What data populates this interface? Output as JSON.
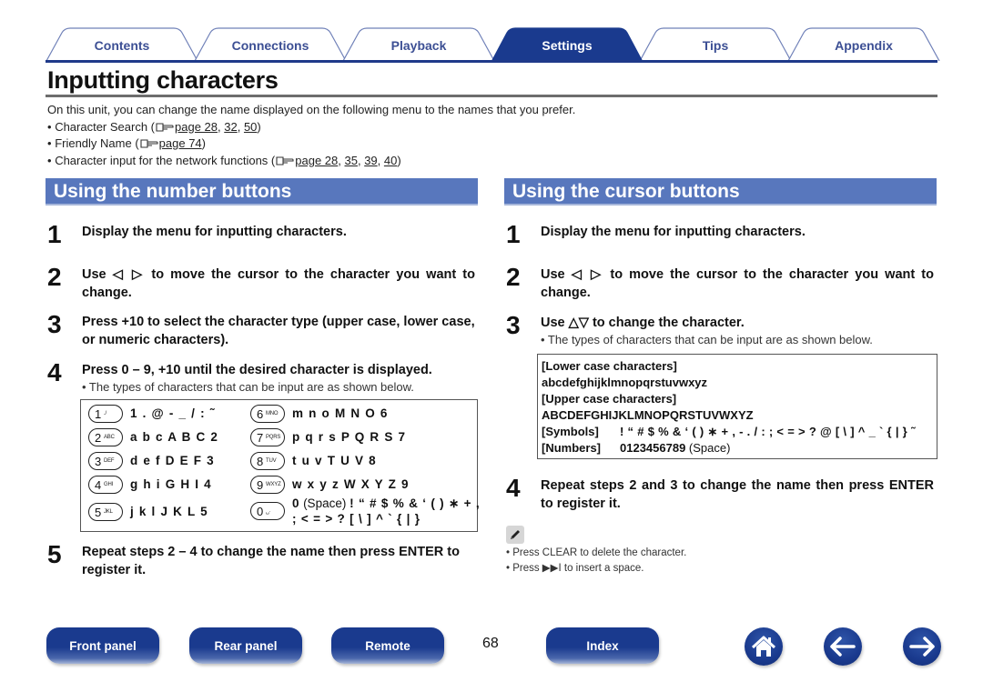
{
  "tabs": [
    {
      "label": "Contents",
      "active": false
    },
    {
      "label": "Connections",
      "active": false
    },
    {
      "label": "Playback",
      "active": false
    },
    {
      "label": "Settings",
      "active": true
    },
    {
      "label": "Tips",
      "active": false
    },
    {
      "label": "Appendix",
      "active": false
    }
  ],
  "page_title": "Inputting characters",
  "intro": {
    "text": "On this unit, you can change the name displayed on the following menu to the names that you prefer.",
    "items": [
      {
        "label": "Character Search (",
        "links": [
          "page 28",
          "32",
          "50"
        ]
      },
      {
        "label": "Friendly Name (",
        "links": [
          "page 74"
        ]
      },
      {
        "label": "Character input for the network functions (",
        "links": [
          "page 28",
          "35",
          "39",
          "40"
        ]
      }
    ],
    "close": ")",
    "bullet": "•",
    "sep": ", "
  },
  "left": {
    "heading": "Using the number buttons",
    "steps": [
      {
        "num": "1",
        "text": "Display the menu for inputting characters."
      },
      {
        "num": "2",
        "text": "Use ◁ ▷ to move the cursor to the character you want to change."
      },
      {
        "num": "3",
        "text": "Press +10 to select the character type (upper case, lower case, or numeric characters)."
      },
      {
        "num": "4",
        "text": "Press 0 – 9, +10 until the desired character is displayed.",
        "sub": "• The types of characters that can be input are as shown below."
      },
      {
        "num": "5",
        "text": "Repeat steps 2 – 4 to change the name then press ENTER to register it."
      }
    ],
    "keys": [
      {
        "num": "1",
        "letters": "./",
        "chars": "1 . @ - _ / : ˜"
      },
      {
        "num": "2",
        "letters": "ABC",
        "chars": "a b c A B C 2"
      },
      {
        "num": "3",
        "letters": "DEF",
        "chars": "d e f D E F 3"
      },
      {
        "num": "4",
        "letters": "GHI",
        "chars": "g h i G H I 4"
      },
      {
        "num": "5",
        "letters": "JKL",
        "chars": "j k l J K L 5"
      },
      {
        "num": "6",
        "letters": "MNO",
        "chars": "m n o M N O 6"
      },
      {
        "num": "7",
        "letters": "PQRS",
        "chars": "p q r s P Q R S 7"
      },
      {
        "num": "8",
        "letters": "TUV",
        "chars": "t u v T U V 8"
      },
      {
        "num": "9",
        "letters": "WXYZ",
        "chars": "w x y z W X Y Z 9"
      },
      {
        "num": "0",
        "letters": "␣·",
        "chars_bold_1": "0",
        "chars_norm": " (Space) ",
        "chars_bold_2": "! “ # $ % & ‘ ( ) ∗ + ,",
        "chars_line2": "; < = > ? [ \\ ] ^ ` { | }"
      }
    ]
  },
  "right": {
    "heading": "Using the cursor buttons",
    "steps": [
      {
        "num": "1",
        "text": "Display the menu for inputting characters."
      },
      {
        "num": "2",
        "text": "Use ◁ ▷ to move the cursor to the character you want to change."
      },
      {
        "num": "3",
        "text": "Use △▽ to change the character.",
        "sub": "• The types of characters that can be input are as shown below."
      },
      {
        "num": "4",
        "text": "Repeat steps 2 and 3 to change the name then press ENTER to register it."
      }
    ],
    "charset": {
      "lower_label": "[Lower case characters]",
      "lower": "abcdefghijklmnopqrstuvwxyz",
      "upper_label": "[Upper case characters]",
      "upper": "ABCDEFGHIJKLMNOPQRSTUVWXYZ",
      "symbols_label": "[Symbols]",
      "symbols": "! “ # $ % & ‘ ( ) ∗ + , - . / : ; < = > ? @ [ \\ ] ^ _ ` { | } ˜",
      "numbers_label": "[Numbers]",
      "numbers": "0123456789",
      "numbers_note": " (Space)"
    },
    "notes": [
      "• Press CLEAR to delete the character.",
      "• Press ▶▶I to insert a space."
    ]
  },
  "footer": {
    "buttons": [
      "Front panel",
      "Rear panel",
      "Remote",
      "Index"
    ],
    "page_number": "68",
    "icons": [
      "home-icon",
      "back-arrow-icon",
      "forward-arrow-icon"
    ]
  },
  "colors": {
    "accent": "#1a3a8e",
    "section_header": "#5877bd",
    "tab_text": "#3c4f94"
  }
}
